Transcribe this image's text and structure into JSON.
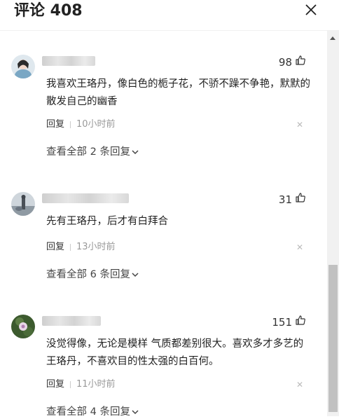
{
  "header": {
    "title": "评论 408"
  },
  "comments": [
    {
      "username": "用户",
      "likes": "98",
      "content": "我喜欢王珞丹，像白色的栀子花，不骄不躁不争艳，默默的散发自己的幽香",
      "reply_label": "回复",
      "time": "10小时前",
      "more_replies": "查看全部 2 条回复"
    },
    {
      "username": "用户",
      "likes": "31",
      "content": "先有王珞丹，后才有白拜合",
      "reply_label": "回复",
      "time": "13小时前",
      "more_replies": "查看全部 6 条回复"
    },
    {
      "username": "用户",
      "likes": "151",
      "content": "没觉得像，无论是模样 气质都差别很大。喜欢多才多艺的王珞丹，不喜欢目的性太强的白百何。",
      "reply_label": "回复",
      "time": "11小时前",
      "more_replies": "查看全部 4 条回复"
    }
  ],
  "icons": {
    "close": "close-icon",
    "like": "thumbs-up-icon",
    "delete": "close-small-icon",
    "chevron": "chevron-down-icon"
  },
  "colors": {
    "text": "#222222",
    "muted": "#999999",
    "background": "#ffffff"
  }
}
